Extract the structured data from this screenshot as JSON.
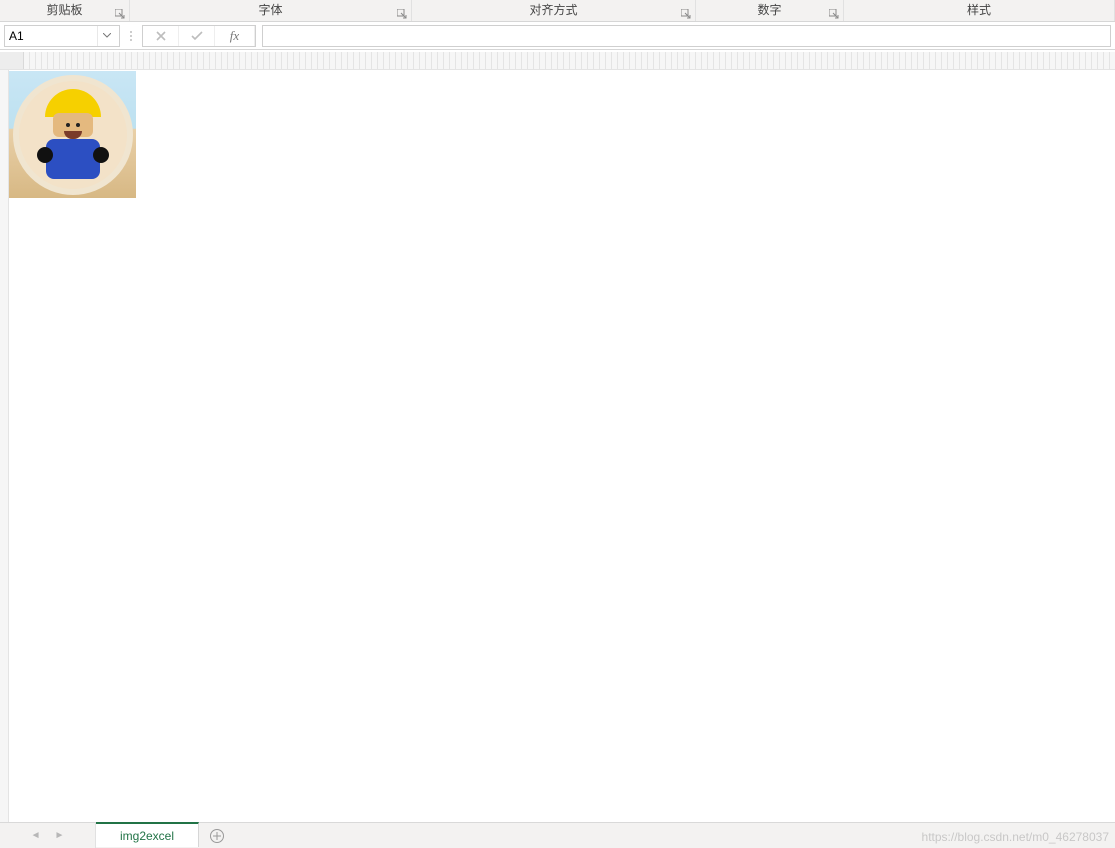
{
  "ribbon": {
    "groups": [
      {
        "id": "clipboard",
        "label": "剪贴板",
        "launcher": true
      },
      {
        "id": "font",
        "label": "字体",
        "launcher": true
      },
      {
        "id": "align",
        "label": "对齐方式",
        "launcher": true
      },
      {
        "id": "number",
        "label": "数字",
        "launcher": true
      },
      {
        "id": "styles",
        "label": "样式",
        "launcher": false
      }
    ]
  },
  "nameBox": {
    "value": "A1"
  },
  "formulaBar": {
    "cancelIcon": "cancel-icon",
    "confirmIcon": "confirm-icon",
    "fxLabel": "fx",
    "value": ""
  },
  "sheet": {
    "activeTab": "img2excel",
    "tabs": [
      "img2excel"
    ]
  },
  "watermark": "https://blog.csdn.net/m0_46278037",
  "colors": {
    "brand": "#217346",
    "ribbonBg": "#f3f2f1",
    "border": "#d6d6d6"
  }
}
